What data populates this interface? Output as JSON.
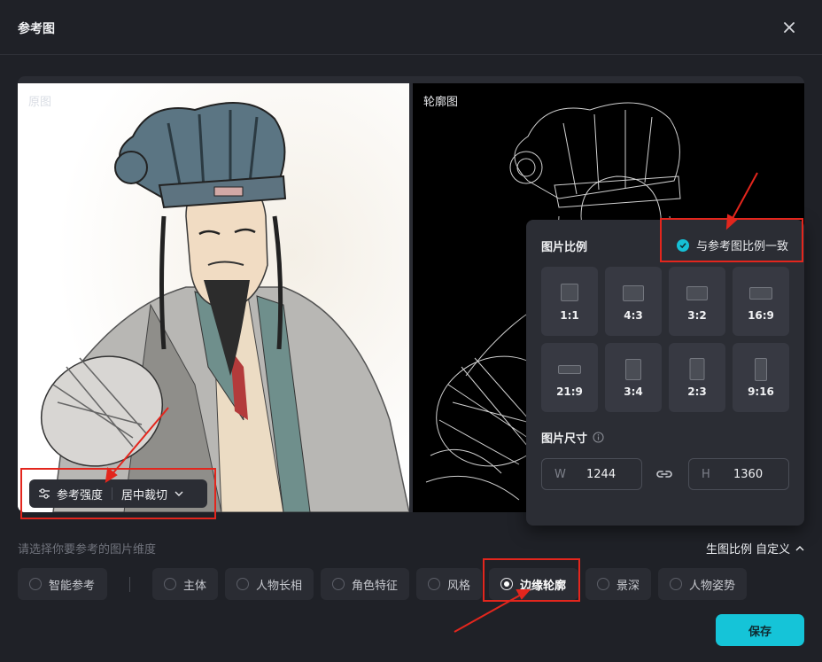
{
  "dialog": {
    "title": "参考图"
  },
  "images": {
    "left_label": "原图",
    "right_label": "轮廓图"
  },
  "ref_toolbar": {
    "strength_label": "参考强度",
    "crop_label": "居中裁切"
  },
  "ratio_panel": {
    "title": "图片比例",
    "match_label": "与参考图比例一致",
    "ratios": [
      "1:1",
      "4:3",
      "3:2",
      "16:9",
      "21:9",
      "3:4",
      "2:3",
      "9:16"
    ],
    "size_title": "图片尺寸",
    "width_prefix": "W",
    "width_value": "1244",
    "height_prefix": "H",
    "height_value": "1360"
  },
  "footer": {
    "hint": "请选择你要参考的图片维度",
    "ratio_setting": "生图比例 自定义",
    "chips": [
      "智能参考",
      "主体",
      "人物长相",
      "角色特征",
      "风格",
      "边缘轮廓",
      "景深",
      "人物姿势"
    ],
    "active_chip": "边缘轮廓",
    "save_label": "保存"
  },
  "colors": {
    "accent": "#15c4d8",
    "annotation": "#e3261d",
    "background": "#1f2127"
  },
  "icons": {
    "close": "close-icon",
    "sliders": "sliders-icon",
    "chevron": "chevron-down-icon",
    "link": "link-icon",
    "info": "info-icon",
    "check": "check-circle-icon"
  }
}
